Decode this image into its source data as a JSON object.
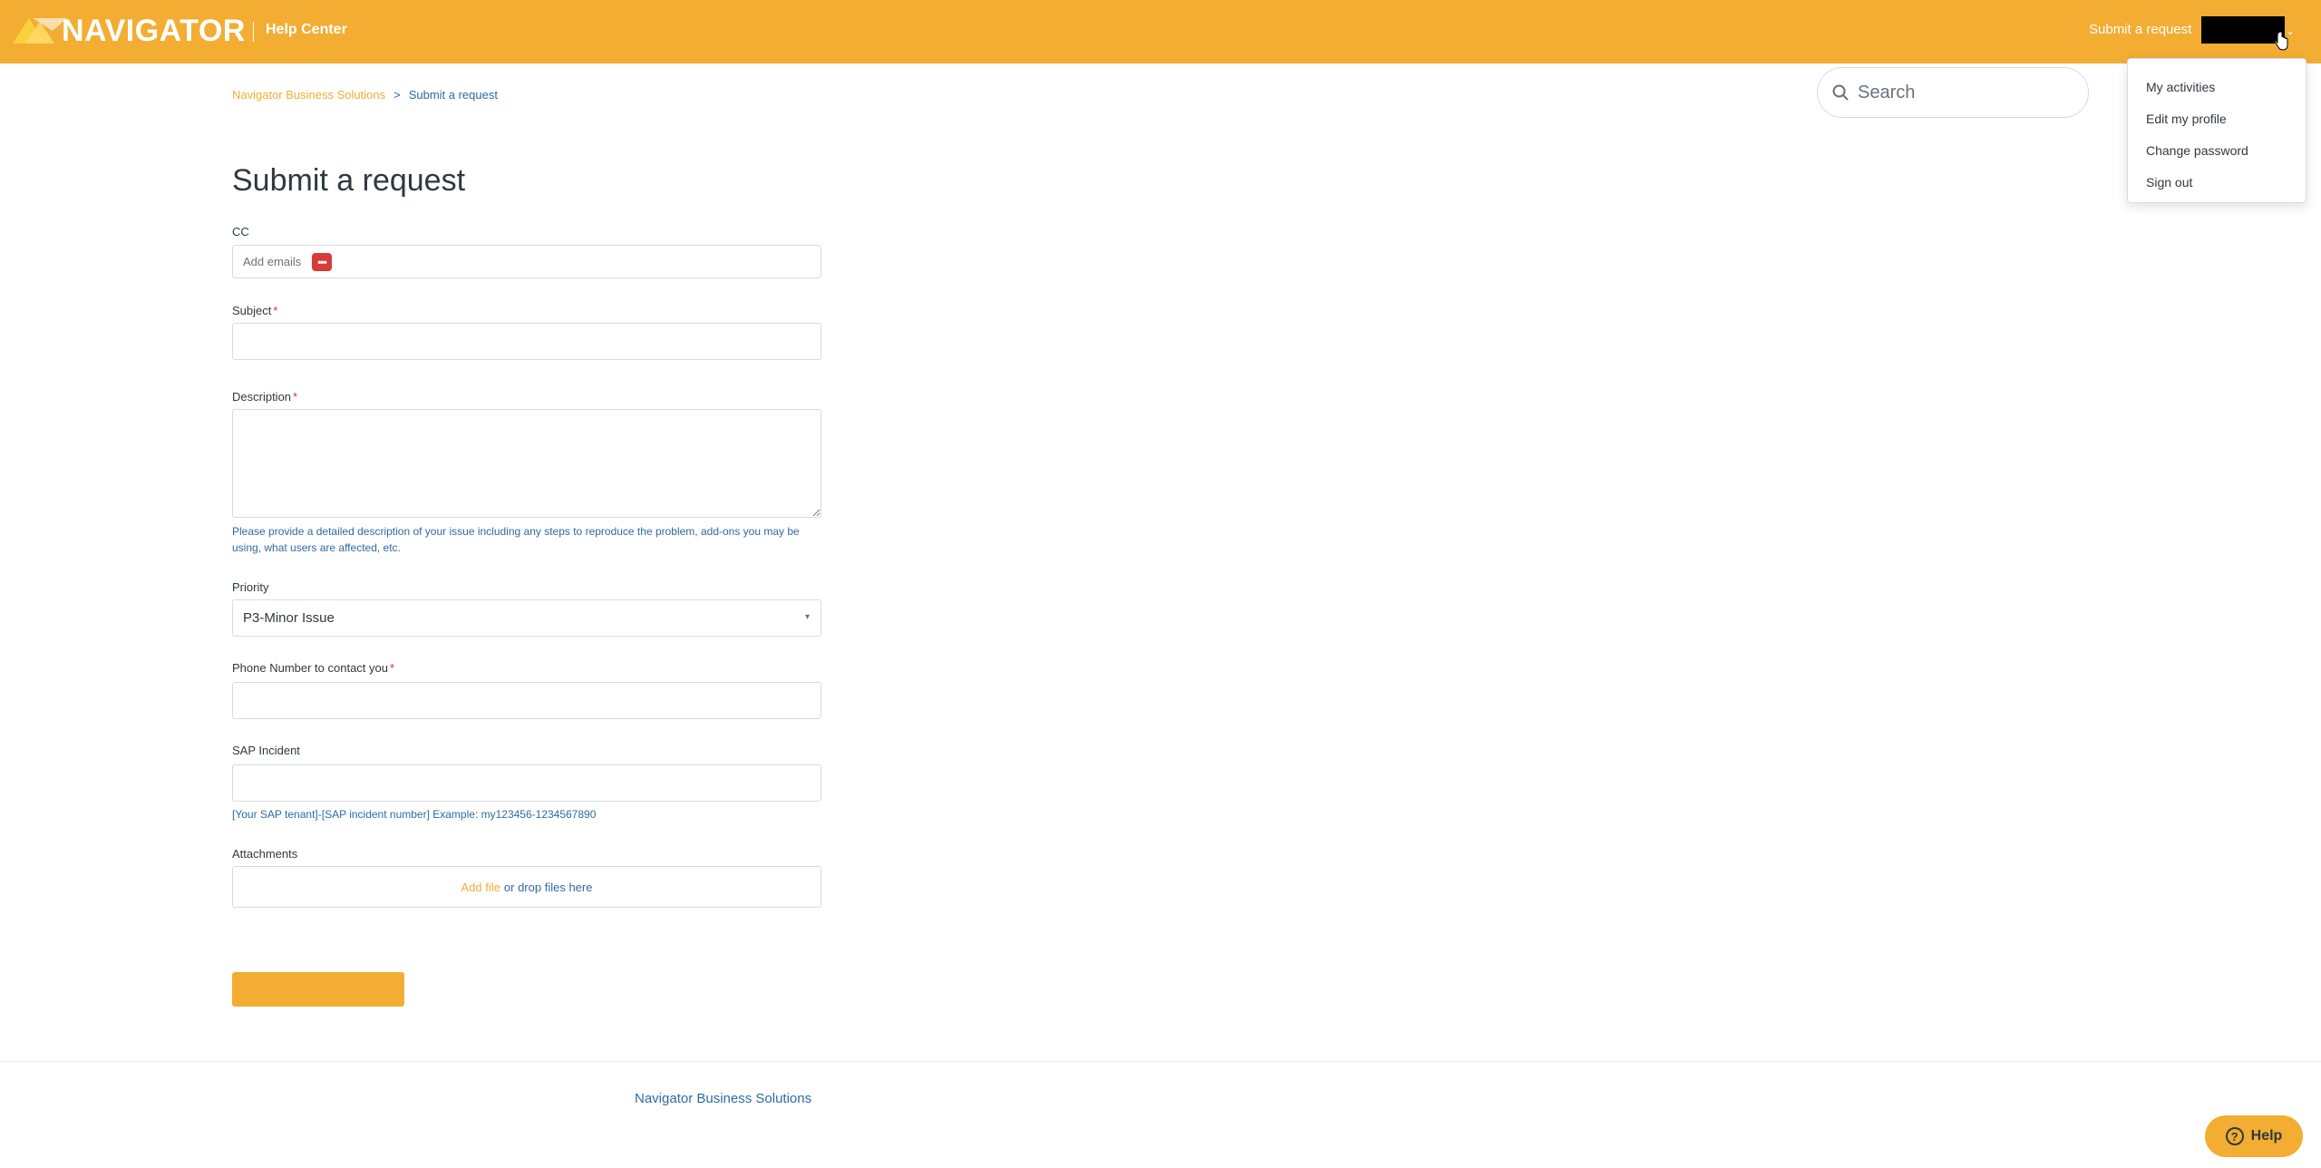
{
  "header": {
    "logo_text": "NAVIGATOR",
    "help_center_label": "Help Center",
    "submit_request_link": "Submit a request",
    "brand_color": "#f2ad32"
  },
  "user_menu": {
    "items": [
      "My activities",
      "Edit my profile",
      "Change password",
      "Sign out"
    ]
  },
  "breadcrumb": {
    "root": "Navigator Business Solutions",
    "separator": ">",
    "current": "Submit a request"
  },
  "search": {
    "placeholder": "Search",
    "icon": "search-icon"
  },
  "form": {
    "title": "Submit a request",
    "cc": {
      "label": "CC",
      "placeholder": "Add emails"
    },
    "subject": {
      "label": "Subject",
      "required_mark": "*",
      "value": ""
    },
    "description": {
      "label": "Description",
      "required_mark": "*",
      "value": "",
      "hint": "Please provide a detailed description of your issue including any steps to reproduce the problem, add-ons you may be using, what users are affected, etc."
    },
    "priority": {
      "label": "Priority",
      "selected": "P3-Minor Issue",
      "caret": "▾"
    },
    "phone": {
      "label": "Phone Number to contact you",
      "required_mark": "*",
      "value": ""
    },
    "sap_incident": {
      "label": "SAP Incident",
      "value": "",
      "hint": "[Your SAP tenant]-[SAP incident number] Example: my123456-1234567890"
    },
    "attachments": {
      "label": "Attachments",
      "add_file": "Add file",
      "drop_text": "or drop files here"
    },
    "submit_label": ""
  },
  "footer": {
    "link": "Navigator Business Solutions"
  },
  "help_button": {
    "label": "Help",
    "icon_glyph": "?"
  }
}
